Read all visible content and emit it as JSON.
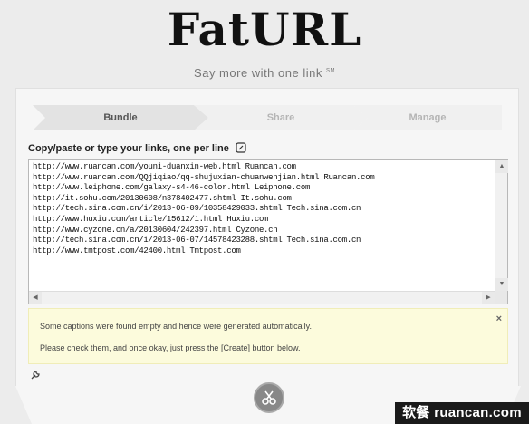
{
  "app": {
    "logo": "FatURL",
    "tagline": "Say more with one link",
    "tagline_mark": "SM"
  },
  "steps": [
    {
      "label": "Bundle",
      "active": true
    },
    {
      "label": "Share",
      "active": false
    },
    {
      "label": "Manage",
      "active": false
    }
  ],
  "links_label": "Copy/paste or type your links, one per line",
  "links_text": "http://www.ruancan.com/youni-duanxin-web.html Ruancan.com\nhttp://www.ruancan.com/QQjiqiao/qq-shujuxian-chuanwenjian.html Ruancan.com\nhttp://www.leiphone.com/galaxy-s4-46-color.html Leiphone.com\nhttp://it.sohu.com/20130608/n378402477.shtml It.sohu.com\nhttp://tech.sina.com.cn/i/2013-06-09/10358429033.shtml Tech.sina.com.cn\nhttp://www.huxiu.com/article/15612/1.html Huxiu.com\nhttp://www.cyzone.cn/a/20130604/242397.html Cyzone.cn\nhttp://tech.sina.com.cn/i/2013-06-07/14578423288.shtml Tech.sina.com.cn\nhttp://www.tmtpost.com/42400.html Tmtpost.com",
  "notice": {
    "line1": "Some captions were found empty and hence were generated automatically.",
    "line2": "Please check them, and once okay, just press the [Create] button below.",
    "close": "×"
  },
  "scroll": {
    "up": "▲",
    "down": "▼",
    "left": "◀",
    "right": "▶"
  },
  "icons": {
    "label_icon": "edit-icon",
    "wrench": "wrench-icon",
    "create": "scissors-icon"
  },
  "watermark": "软餐 ruancan.com",
  "colors": {
    "background": "#ececec",
    "panel": "#f6f6f6",
    "notice_bg": "#fcfbdc",
    "active_step": "#e3e3e3",
    "inactive_step": "#f0f0f0"
  }
}
